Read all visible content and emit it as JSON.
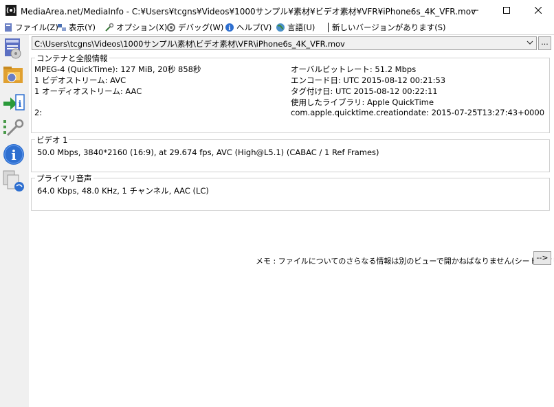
{
  "window": {
    "title": "MediaArea.net/MediaInfo - C:¥Users¥tcgns¥Videos¥1000サンプル¥素材¥ビデオ素材¥VFR¥iPhone6s_4K_VFR.mov"
  },
  "menu": {
    "items": [
      {
        "label": "ファイル(Z)"
      },
      {
        "label": "表示(Y)"
      },
      {
        "label": "オプション(X)"
      },
      {
        "label": "デバッグ(W)"
      },
      {
        "label": "ヘルプ(V)"
      },
      {
        "label": "言語(U)"
      }
    ],
    "update_notice": "新しいバージョンがあります(S)"
  },
  "file_combo": {
    "value": "C:\\Users\\tcgns\\Videos\\1000サンプル\\素材\\ビデオ素材\\VFR\\iPhone6s_4K_VFR.mov",
    "browse_label": "..."
  },
  "general": {
    "label": "コンテナと全般情報",
    "left": [
      "MPEG-4 (QuickTime): 127 MiB, 20秒 858秒",
      "1 ビデオストリーム: AVC",
      "1 オーディオストリーム: AAC",
      "",
      "2:"
    ],
    "right": [
      "オーバルビットレート: 51.2 Mbps",
      "エンコード日: UTC 2015-08-12 00:21:53",
      "タグ付け日: UTC 2015-08-12 00:22:11",
      "使用したライブラリ: Apple QuickTime",
      "com.apple.quicktime.creationdate: 2015-07-25T13:27:43+0000"
    ]
  },
  "video": {
    "label": "ビデオ 1",
    "line": "50.0 Mbps, 3840*2160 (16:9), at 29.674 fps, AVC (High@L5.1) (CABAC / 1 Ref Frames)"
  },
  "audio": {
    "label": "プライマリ音声",
    "line": "64.0 Kbps, 48.0 KHz, 1 チャンネル, AAC (LC)"
  },
  "note": {
    "text": "メモ : ファイルについてのさらなる情報は別のビューで開かねばなりません(シート、ツリー...)",
    "button": "-->"
  }
}
